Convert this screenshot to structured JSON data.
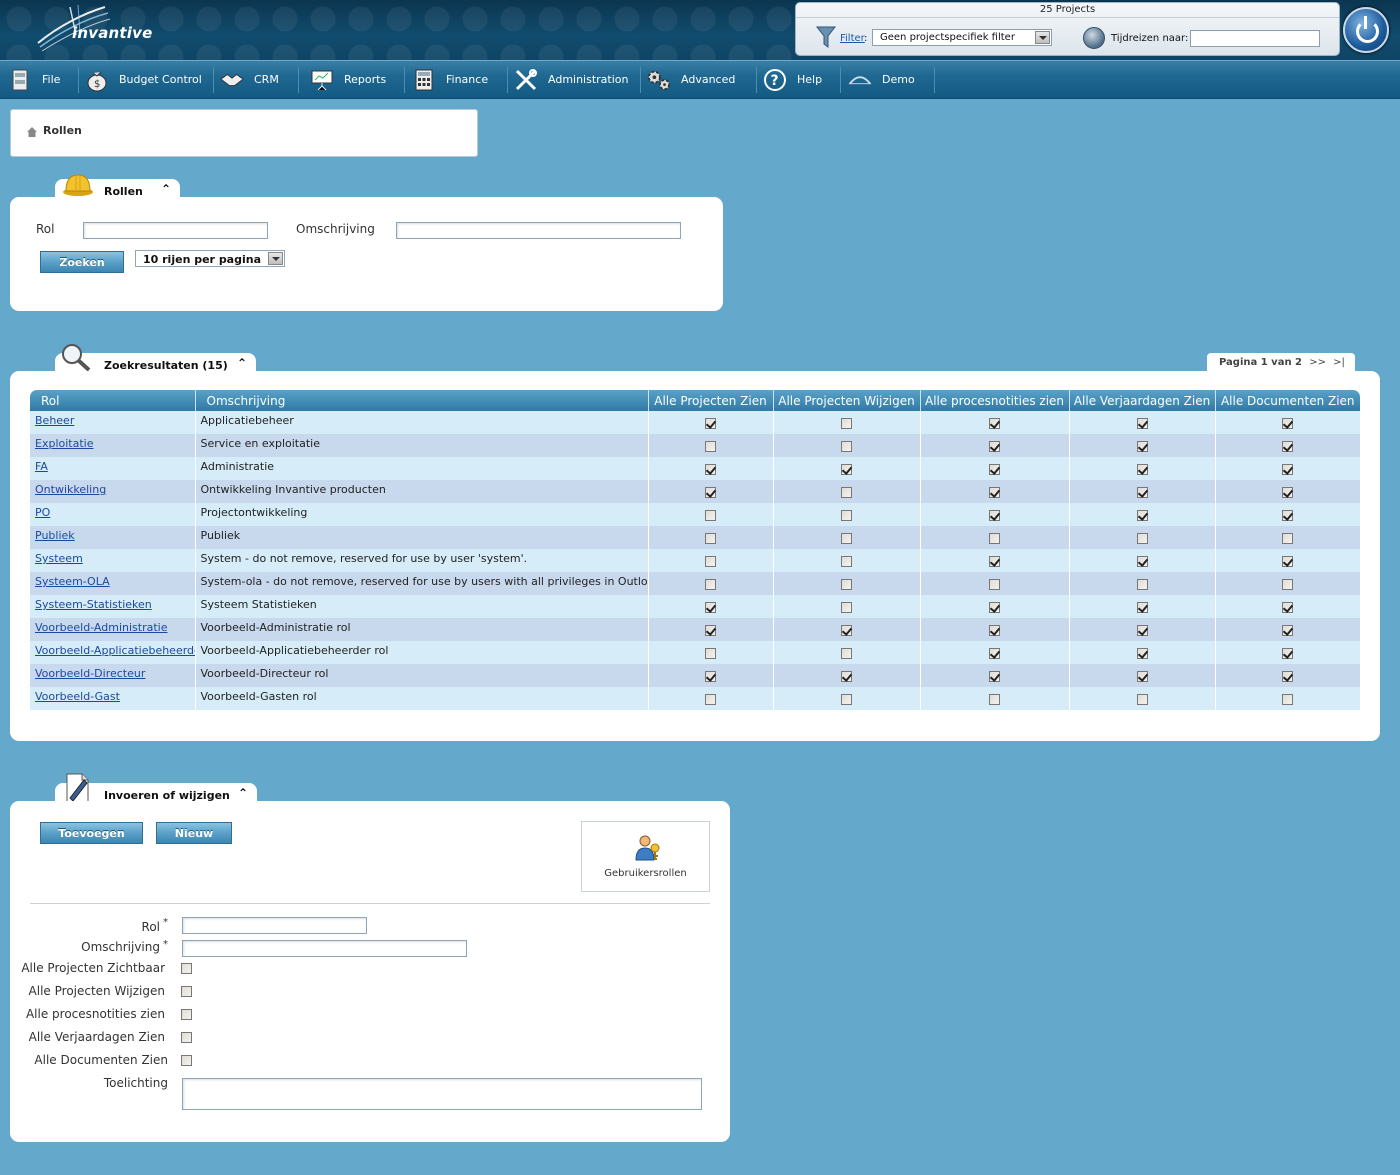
{
  "header": {
    "logo_text": "invantive",
    "project_count": "25 Projects",
    "filter_link": "Filter",
    "filter_colon": ":",
    "filter_value": "Geen projectspecifiek filter",
    "time_travel_label": "Tijdreizen naar:",
    "time_travel_value": ""
  },
  "menu": [
    {
      "label": "File",
      "icon": "file-cabinet-icon"
    },
    {
      "label": "Budget Control",
      "icon": "money-bag-icon"
    },
    {
      "label": "CRM",
      "icon": "handshake-icon"
    },
    {
      "label": "Reports",
      "icon": "presentation-board-icon"
    },
    {
      "label": "Finance",
      "icon": "calculator-icon"
    },
    {
      "label": "Administration",
      "icon": "tools-icon"
    },
    {
      "label": "Advanced",
      "icon": "gears-icon"
    },
    {
      "label": "Help",
      "icon": "question-icon"
    },
    {
      "label": "Demo",
      "icon": "demo-icon"
    }
  ],
  "breadcrumb": {
    "current": "Rollen"
  },
  "search_panel": {
    "tab_title": "Rollen",
    "collapse": "⌃",
    "rol_label": "Rol",
    "rol_value": "",
    "omschrijving_label": "Omschrijving",
    "omschrijving_value": "",
    "search_button": "Zoeken",
    "rows_per_page": "10 rijen per pagina"
  },
  "results_panel": {
    "tab_title": "Zoekresultaten (15)",
    "pager_text": "Pagina 1 van 2",
    "pager_next": ">>",
    "pager_last": ">|",
    "columns": [
      "Rol",
      "Omschrijving",
      "Alle Projecten Zien",
      "Alle Projecten Wijzigen",
      "Alle procesnotities zien",
      "Alle Verjaardagen Zien",
      "Alle Documenten Zien"
    ],
    "rows": [
      {
        "rol": "Beheer",
        "omschrijving": "Applicatiebeheer",
        "flags": [
          1,
          0,
          1,
          1,
          1
        ]
      },
      {
        "rol": "Exploitatie",
        "omschrijving": "Service en exploitatie",
        "flags": [
          0,
          0,
          1,
          1,
          1
        ]
      },
      {
        "rol": "FA",
        "omschrijving": "Administratie",
        "flags": [
          1,
          1,
          1,
          1,
          1
        ]
      },
      {
        "rol": "Ontwikkeling",
        "omschrijving": "Ontwikkeling Invantive producten",
        "flags": [
          1,
          0,
          1,
          1,
          1
        ]
      },
      {
        "rol": "PO",
        "omschrijving": "Projectontwikkeling",
        "flags": [
          0,
          0,
          1,
          1,
          1
        ]
      },
      {
        "rol": "Publiek",
        "omschrijving": "Publiek",
        "flags": [
          0,
          0,
          0,
          0,
          0
        ]
      },
      {
        "rol": "Systeem",
        "omschrijving": "System - do not remove, reserved for use by user 'system'.",
        "flags": [
          0,
          0,
          1,
          1,
          1
        ]
      },
      {
        "rol": "Systeem-OLA",
        "omschrijving": "System-ola - do not remove, reserved for use by users with all privileges in Outlook Add-in.",
        "flags": [
          0,
          0,
          0,
          0,
          0
        ]
      },
      {
        "rol": "Systeem-Statistieken",
        "omschrijving": "Systeem Statistieken",
        "flags": [
          1,
          0,
          1,
          1,
          1
        ]
      },
      {
        "rol": "Voorbeeld-Administratie",
        "omschrijving": "Voorbeeld-Administratie rol",
        "flags": [
          1,
          1,
          1,
          1,
          1
        ]
      },
      {
        "rol": "Voorbeeld-Applicatiebeheerder",
        "omschrijving": "Voorbeeld-Applicatiebeheerder rol",
        "flags": [
          0,
          0,
          1,
          1,
          1
        ]
      },
      {
        "rol": "Voorbeeld-Directeur",
        "omschrijving": "Voorbeeld-Directeur rol",
        "flags": [
          1,
          1,
          1,
          1,
          1
        ]
      },
      {
        "rol": "Voorbeeld-Gast",
        "omschrijving": "Voorbeeld-Gasten rol",
        "flags": [
          0,
          0,
          0,
          0,
          0
        ]
      }
    ]
  },
  "edit_panel": {
    "tab_title": "Invoeren of wijzigen",
    "add_button": "Toevoegen",
    "new_button": "Nieuw",
    "user_roles_label": "Gebruikersrollen",
    "required_mark": "*",
    "fields": {
      "rol": "Rol",
      "omschrijving": "Omschrijving",
      "alle_projecten_zichtbaar": "Alle Projecten Zichtbaar",
      "alle_projecten_wijzigen": "Alle Projecten Wijzigen",
      "alle_procesnotities_zien": "Alle procesnotities zien",
      "alle_verjaardagen_zien": "Alle Verjaardagen Zien",
      "alle_documenten_zien": "Alle Documenten Zien",
      "toelichting": "Toelichting"
    }
  }
}
